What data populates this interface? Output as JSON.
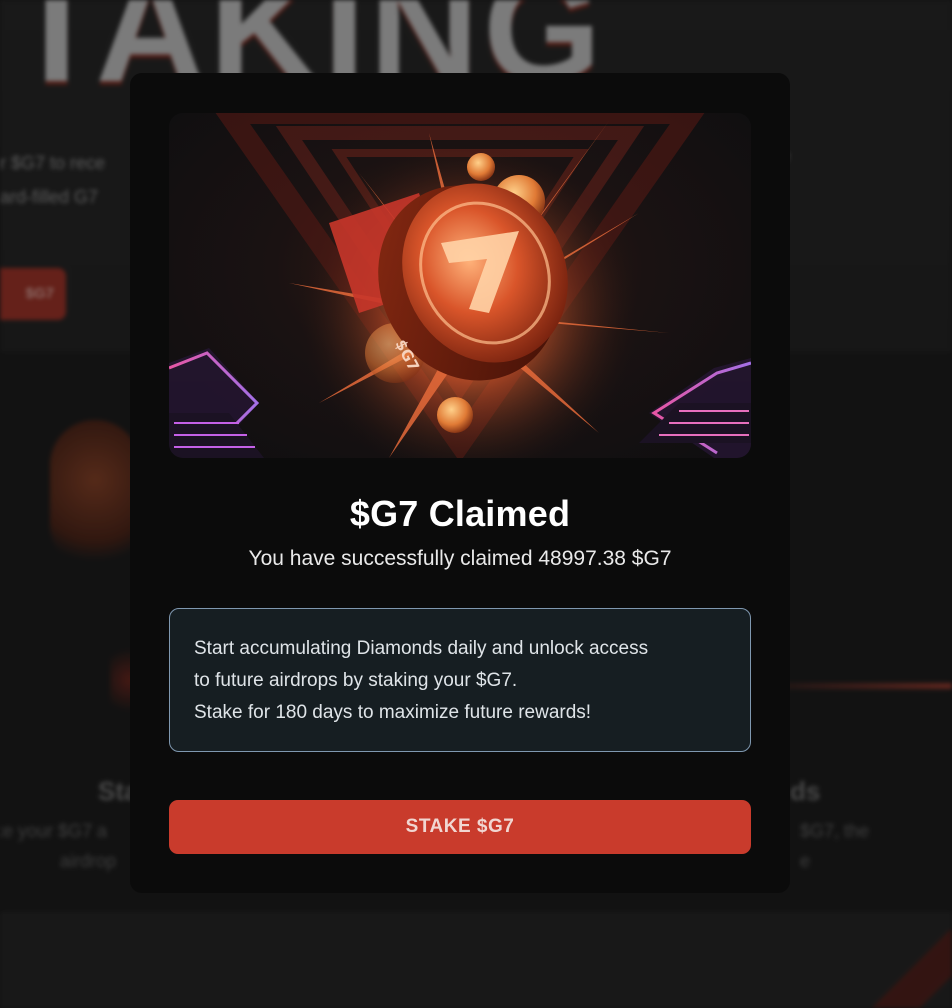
{
  "background": {
    "hero_title": "TAKING",
    "hero_desc_line1": "r $G7 to rece",
    "hero_desc_line2": "ard-filled G7",
    "hero_desc_right": "e",
    "hero_button_label": "$G7",
    "card_left_title": "Sta",
    "card_left_text_line1": "ke your $G7 a",
    "card_left_text_line2": "airdrop",
    "card_right_title": "ds",
    "card_right_text_line1": "$G7, the",
    "card_right_text_line2": "e"
  },
  "modal": {
    "title": "$G7 Claimed",
    "subtitle": "You have successfully claimed 48997.38 $G7",
    "info_line1": "Start accumulating Diamonds daily and unlock access",
    "info_line2": "to future airdrops by staking your $G7.",
    "info_line3": "Stake for 180 days to maximize future rewards!",
    "button_label": "STAKE $G7",
    "coin_label": "$G7"
  },
  "colors": {
    "accent": "#c93b2c",
    "modal_bg": "#0b0b0b",
    "info_border": "#7f98b0",
    "info_bg": "#161e22"
  }
}
